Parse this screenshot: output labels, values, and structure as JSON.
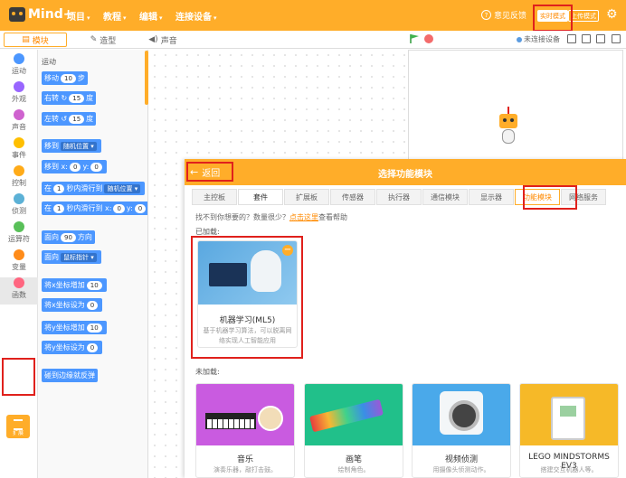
{
  "header": {
    "logo_text": "Mind+",
    "menus": [
      {
        "label": "项目"
      },
      {
        "label": "教程"
      },
      {
        "label": "编辑"
      },
      {
        "label": "连接设备"
      }
    ],
    "feedback_label": "意见反馈",
    "mode_live": "实时模式",
    "mode_upload": "上传模式"
  },
  "tabs": {
    "blocks": "模块",
    "costumes": "造型",
    "sounds": "声音"
  },
  "stage_bar": {
    "connection_status": "未连接设备"
  },
  "categories": [
    {
      "label": "运动",
      "color": "#4c97ff"
    },
    {
      "label": "外观",
      "color": "#9966ff"
    },
    {
      "label": "声音",
      "color": "#cf63cf"
    },
    {
      "label": "事件",
      "color": "#ffbf00"
    },
    {
      "label": "控制",
      "color": "#ffab19"
    },
    {
      "label": "侦测",
      "color": "#5cb1d6"
    },
    {
      "label": "运算符",
      "color": "#59c059"
    },
    {
      "label": "变量",
      "color": "#ff8c1a"
    },
    {
      "label": "函数",
      "color": "#ff6680"
    }
  ],
  "extension_button": "扩展",
  "palette": {
    "title": "运动",
    "blocks": [
      {
        "pre": "移动",
        "num": "10",
        "post": "步"
      },
      {
        "pre": "右转 ↻",
        "num": "15",
        "post": "度"
      },
      {
        "pre": "左转 ↺",
        "num": "15",
        "post": "度"
      },
      {
        "pre": "移到",
        "dd": "随机位置 ▾"
      },
      {
        "pre": "移到 x:",
        "num": "0",
        "mid": "y:",
        "num2": "0"
      },
      {
        "pre": "在",
        "num": "1",
        "mid": "秒内滑行到",
        "dd": "随机位置 ▾"
      },
      {
        "pre": "在",
        "num": "1",
        "mid": "秒内滑行到 x:",
        "num2": "0",
        "mid2": "y:",
        "num3": "0"
      },
      {
        "pre": "面向",
        "num": "90",
        "post": "方向"
      },
      {
        "pre": "面向",
        "dd": "鼠标指针 ▾"
      },
      {
        "pre": "将x坐标增加",
        "num": "10"
      },
      {
        "pre": "将x坐标设为",
        "num": "0"
      },
      {
        "pre": "将y坐标增加",
        "num": "10"
      },
      {
        "pre": "将y坐标设为",
        "num": "0"
      },
      {
        "pre": "碰到边缘就反弹"
      }
    ]
  },
  "dialog": {
    "back_label": "返回",
    "title": "选择功能模块",
    "tabs": [
      "主控板",
      "套件",
      "扩展板",
      "传感器",
      "执行器",
      "通信模块",
      "显示器",
      "功能模块",
      "网络服务"
    ],
    "help_text": "找不到你想要的？数量很少？",
    "help_link": "点击这里",
    "help_tail": "查看帮助",
    "loaded_label": "已加载:",
    "unloaded_label": "未加载:",
    "loaded": [
      {
        "name": "机器学习(ML5)",
        "desc": "基于机器学习算法，可以脱离网络实现人工智能应用"
      }
    ],
    "unloaded": [
      {
        "name": "音乐",
        "desc": "演奏乐器，敲打击鼓。"
      },
      {
        "name": "画笔",
        "desc": "绘制角色。"
      },
      {
        "name": "视频侦测",
        "desc": "用摄像头侦测动作。"
      },
      {
        "name": "LEGO MINDSTORMS EV3",
        "desc": "搭建交互机器人等。"
      }
    ]
  }
}
